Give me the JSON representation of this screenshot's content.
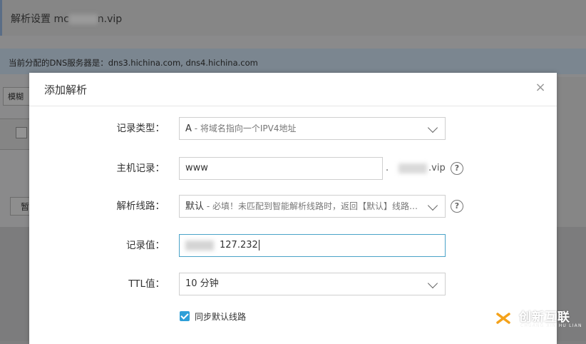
{
  "background": {
    "title_prefix": "解析设置 mc",
    "title_suffix": "n.vip",
    "dns_notice": "当前分配的DNS服务器是：dns3.hichina.com, dns4.hichina.com",
    "search_label": "模糊搜",
    "batch_button": "暂"
  },
  "modal": {
    "title": "添加解析",
    "close_icon": "close-icon",
    "fields": {
      "record_type": {
        "label": "记录类型：",
        "value": "A",
        "hint": " - 将域名指向一个IPV4地址"
      },
      "host": {
        "label": "主机记录：",
        "value": "www",
        "suffix_dot": ".",
        "suffix_domain": ".vip"
      },
      "line": {
        "label": "解析线路：",
        "value": "默认",
        "hint": " - 必填！未匹配到智能解析线路时，返回【默认】线路…"
      },
      "record_value": {
        "label": "记录值：",
        "value": "127.232"
      },
      "ttl": {
        "label": "TTL值：",
        "value": "10 分钟"
      }
    },
    "sync_checkbox": {
      "label": "同步默认线路",
      "checked": true
    }
  },
  "watermark": {
    "brand": "创新互联",
    "sub": "CHUANG XIN HU LIAN"
  },
  "colors": {
    "accent": "#2e9fd8",
    "focus_border": "#4aa3c8",
    "overlay": "#7f7f80"
  }
}
